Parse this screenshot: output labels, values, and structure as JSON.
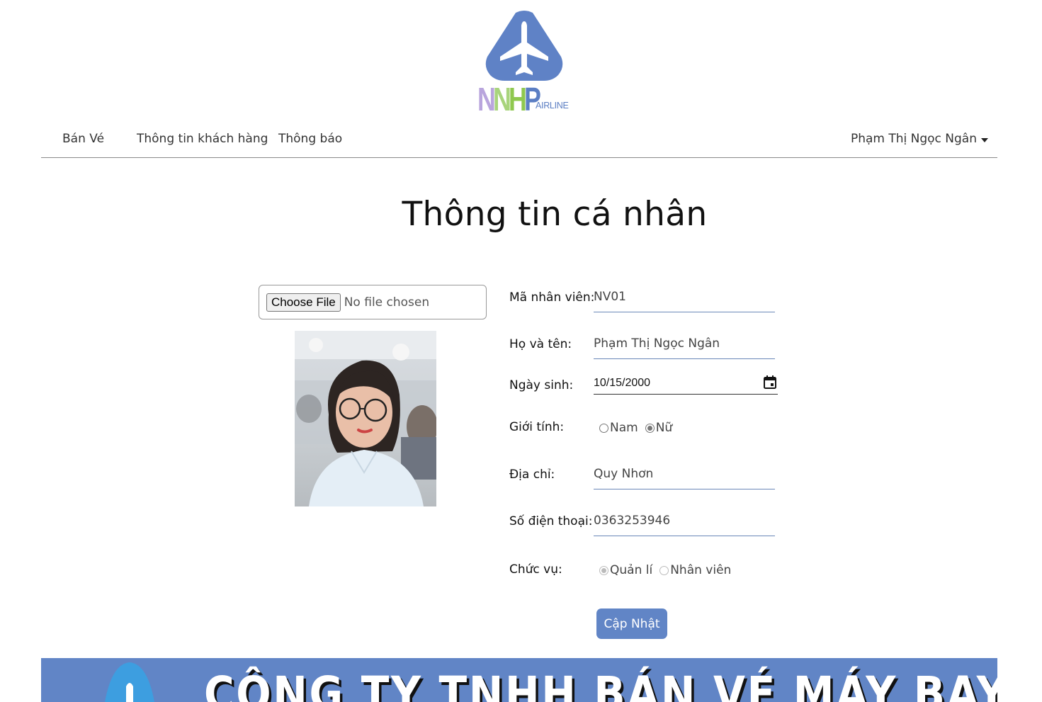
{
  "logo": {
    "word_letters": [
      "N",
      "N",
      "H",
      "P"
    ],
    "subtext": "AIRLINE",
    "colors": [
      "#b9a5dd",
      "#a8d47c",
      "#8fc84f",
      "#5b7ec3"
    ]
  },
  "nav": {
    "items": [
      {
        "label": "Bán Vé"
      },
      {
        "label": "Thông tin khách hàng"
      },
      {
        "label": "Thông báo"
      }
    ],
    "user": "Phạm Thị Ngọc Ngân"
  },
  "page_title": "Thông tin cá nhân",
  "file_input": {
    "button": "Choose File",
    "status": "No file chosen"
  },
  "form": {
    "employee_id": {
      "label": "Mã nhân viên:",
      "value": "NV01"
    },
    "full_name": {
      "label": "Họ và tên:",
      "value": "Phạm Thị Ngọc Ngân"
    },
    "birthday": {
      "label": "Ngày sinh:",
      "value": "10/15/2000"
    },
    "gender": {
      "label": "Giới tính:",
      "options": [
        "Nam",
        "Nữ"
      ],
      "selected": "Nữ"
    },
    "address": {
      "label": "Địa chỉ:",
      "value": "Quy Nhơn"
    },
    "phone": {
      "label": "Số điện thoại:",
      "value": "0363253946"
    },
    "position": {
      "label": "Chức vụ:",
      "options": [
        "Quản lí",
        "Nhân viên"
      ],
      "selected": "Quản lí",
      "disabled": true
    }
  },
  "submit_label": "Cập Nhật",
  "banner": {
    "text": "CÔNG TY TNHH BÁN VÉ MÁY BAY"
  },
  "colors": {
    "accent": "#6185c6",
    "border": "#6a87b8"
  }
}
